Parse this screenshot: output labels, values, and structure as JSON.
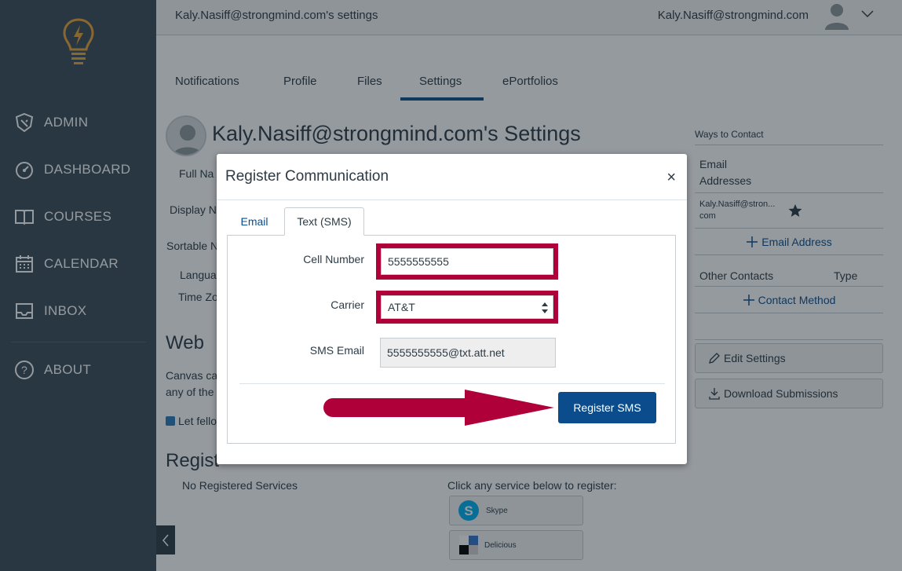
{
  "nav": {
    "items": [
      {
        "label": "ADMIN",
        "icon": "shield-icon"
      },
      {
        "label": "DASHBOARD",
        "icon": "speedometer-icon"
      },
      {
        "label": "COURSES",
        "icon": "book-icon"
      },
      {
        "label": "CALENDAR",
        "icon": "calendar-icon"
      },
      {
        "label": "INBOX",
        "icon": "inbox-icon"
      },
      {
        "label": "ABOUT",
        "icon": "help-icon"
      }
    ]
  },
  "header": {
    "title": "Kaly.Nasiff@strongmind.com's settings",
    "user": "Kaly.Nasiff@strongmind.com"
  },
  "tabs": [
    "Notifications",
    "Profile",
    "Files",
    "Settings",
    "ePortfolios"
  ],
  "active_tab": "Settings",
  "page": {
    "title": "Kaly.Nasiff@strongmind.com's Settings",
    "labels": [
      "Full Na",
      "Display N",
      "Sortable N",
      "Langua",
      "Time Zo"
    ],
    "web_services_heading": "Web",
    "web_text_1": "Canvas ca",
    "web_text_2": "any of the",
    "checkbox_label": "Let fello",
    "registered_heading": "Regist",
    "no_services": "No Registered Services",
    "click_service": "Click any service below to register:",
    "services": [
      "Skype",
      "Delicious"
    ]
  },
  "sidebar": {
    "ways_to_contact": "Ways to Contact",
    "email_addresses_line1": "Email",
    "email_addresses_line2": "Addresses",
    "email_value_line1": "Kaly.Nasiff@stron...",
    "email_value_line2": "com",
    "add_email": "Email Address",
    "other_contacts": "Other Contacts",
    "type": "Type",
    "add_contact": "Contact Method",
    "edit_settings": "Edit Settings",
    "download_submissions": "Download Submissions"
  },
  "modal": {
    "title": "Register Communication",
    "close": "×",
    "tabs": [
      "Email",
      "Text (SMS)"
    ],
    "active_tab": "Text (SMS)",
    "cell_label": "Cell Number",
    "cell_value": "5555555555",
    "carrier_label": "Carrier",
    "carrier_value": "AT&T",
    "sms_email_label": "SMS Email",
    "sms_email_value": "5555555555@txt.att.net",
    "submit": "Register SMS"
  },
  "colors": {
    "nav_bg": "#394b58",
    "primary": "#0b4d8c",
    "highlight": "#b0003a",
    "logo": "#e8a33a"
  }
}
